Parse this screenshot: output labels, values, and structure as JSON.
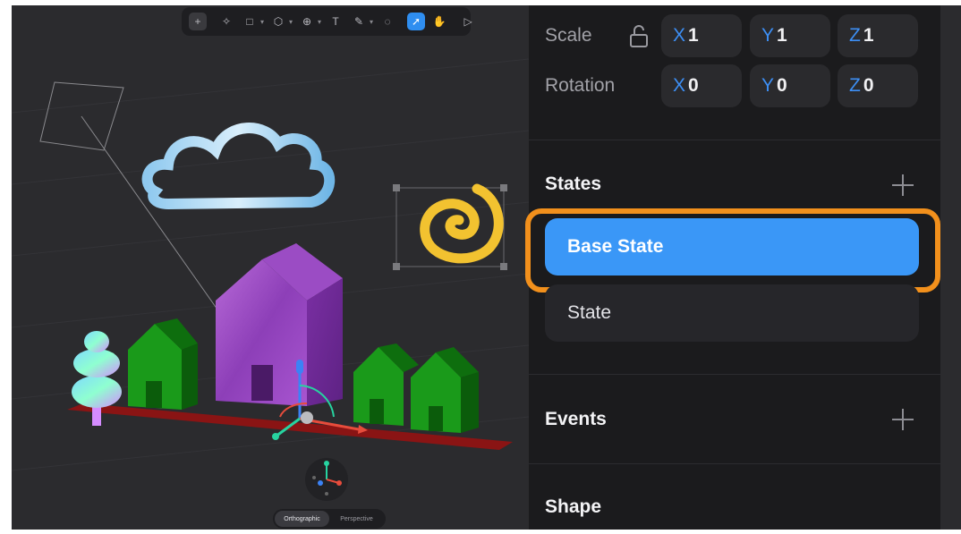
{
  "toolbar": {
    "tools": [
      {
        "name": "add-icon",
        "glyph": "+"
      },
      {
        "name": "sparkle-icon",
        "glyph": "✧"
      },
      {
        "name": "rectangle-icon",
        "glyph": "□"
      },
      {
        "name": "cube-icon",
        "glyph": "⬡"
      },
      {
        "name": "globe-icon",
        "glyph": "⊕"
      },
      {
        "name": "text-icon",
        "glyph": "T"
      },
      {
        "name": "pen-icon",
        "glyph": "✎"
      },
      {
        "name": "comment-icon",
        "glyph": "◌"
      },
      {
        "name": "select-pointer-icon",
        "glyph": "➚"
      },
      {
        "name": "hand-icon",
        "glyph": "✋"
      },
      {
        "name": "play-icon",
        "glyph": "▷"
      }
    ]
  },
  "camera": {
    "options": [
      "Orthographic",
      "Perspective"
    ],
    "selected": "Orthographic"
  },
  "panel": {
    "scale": {
      "label": "Scale",
      "x": "1",
      "y": "1",
      "z": "1"
    },
    "rotation": {
      "label": "Rotation",
      "x": "0",
      "y": "0",
      "z": "0"
    },
    "axis_letters": {
      "x": "X",
      "y": "Y",
      "z": "Z"
    },
    "states": {
      "title": "States",
      "items": [
        "Base State",
        "State"
      ],
      "selected": "Base State"
    },
    "events": {
      "title": "Events"
    },
    "shape": {
      "title": "Shape"
    }
  },
  "colors": {
    "accent": "#3a97f7",
    "highlight": "#f2901c",
    "panel_bg": "#1b1b1d",
    "axis_letter": "#3d8ff5"
  }
}
